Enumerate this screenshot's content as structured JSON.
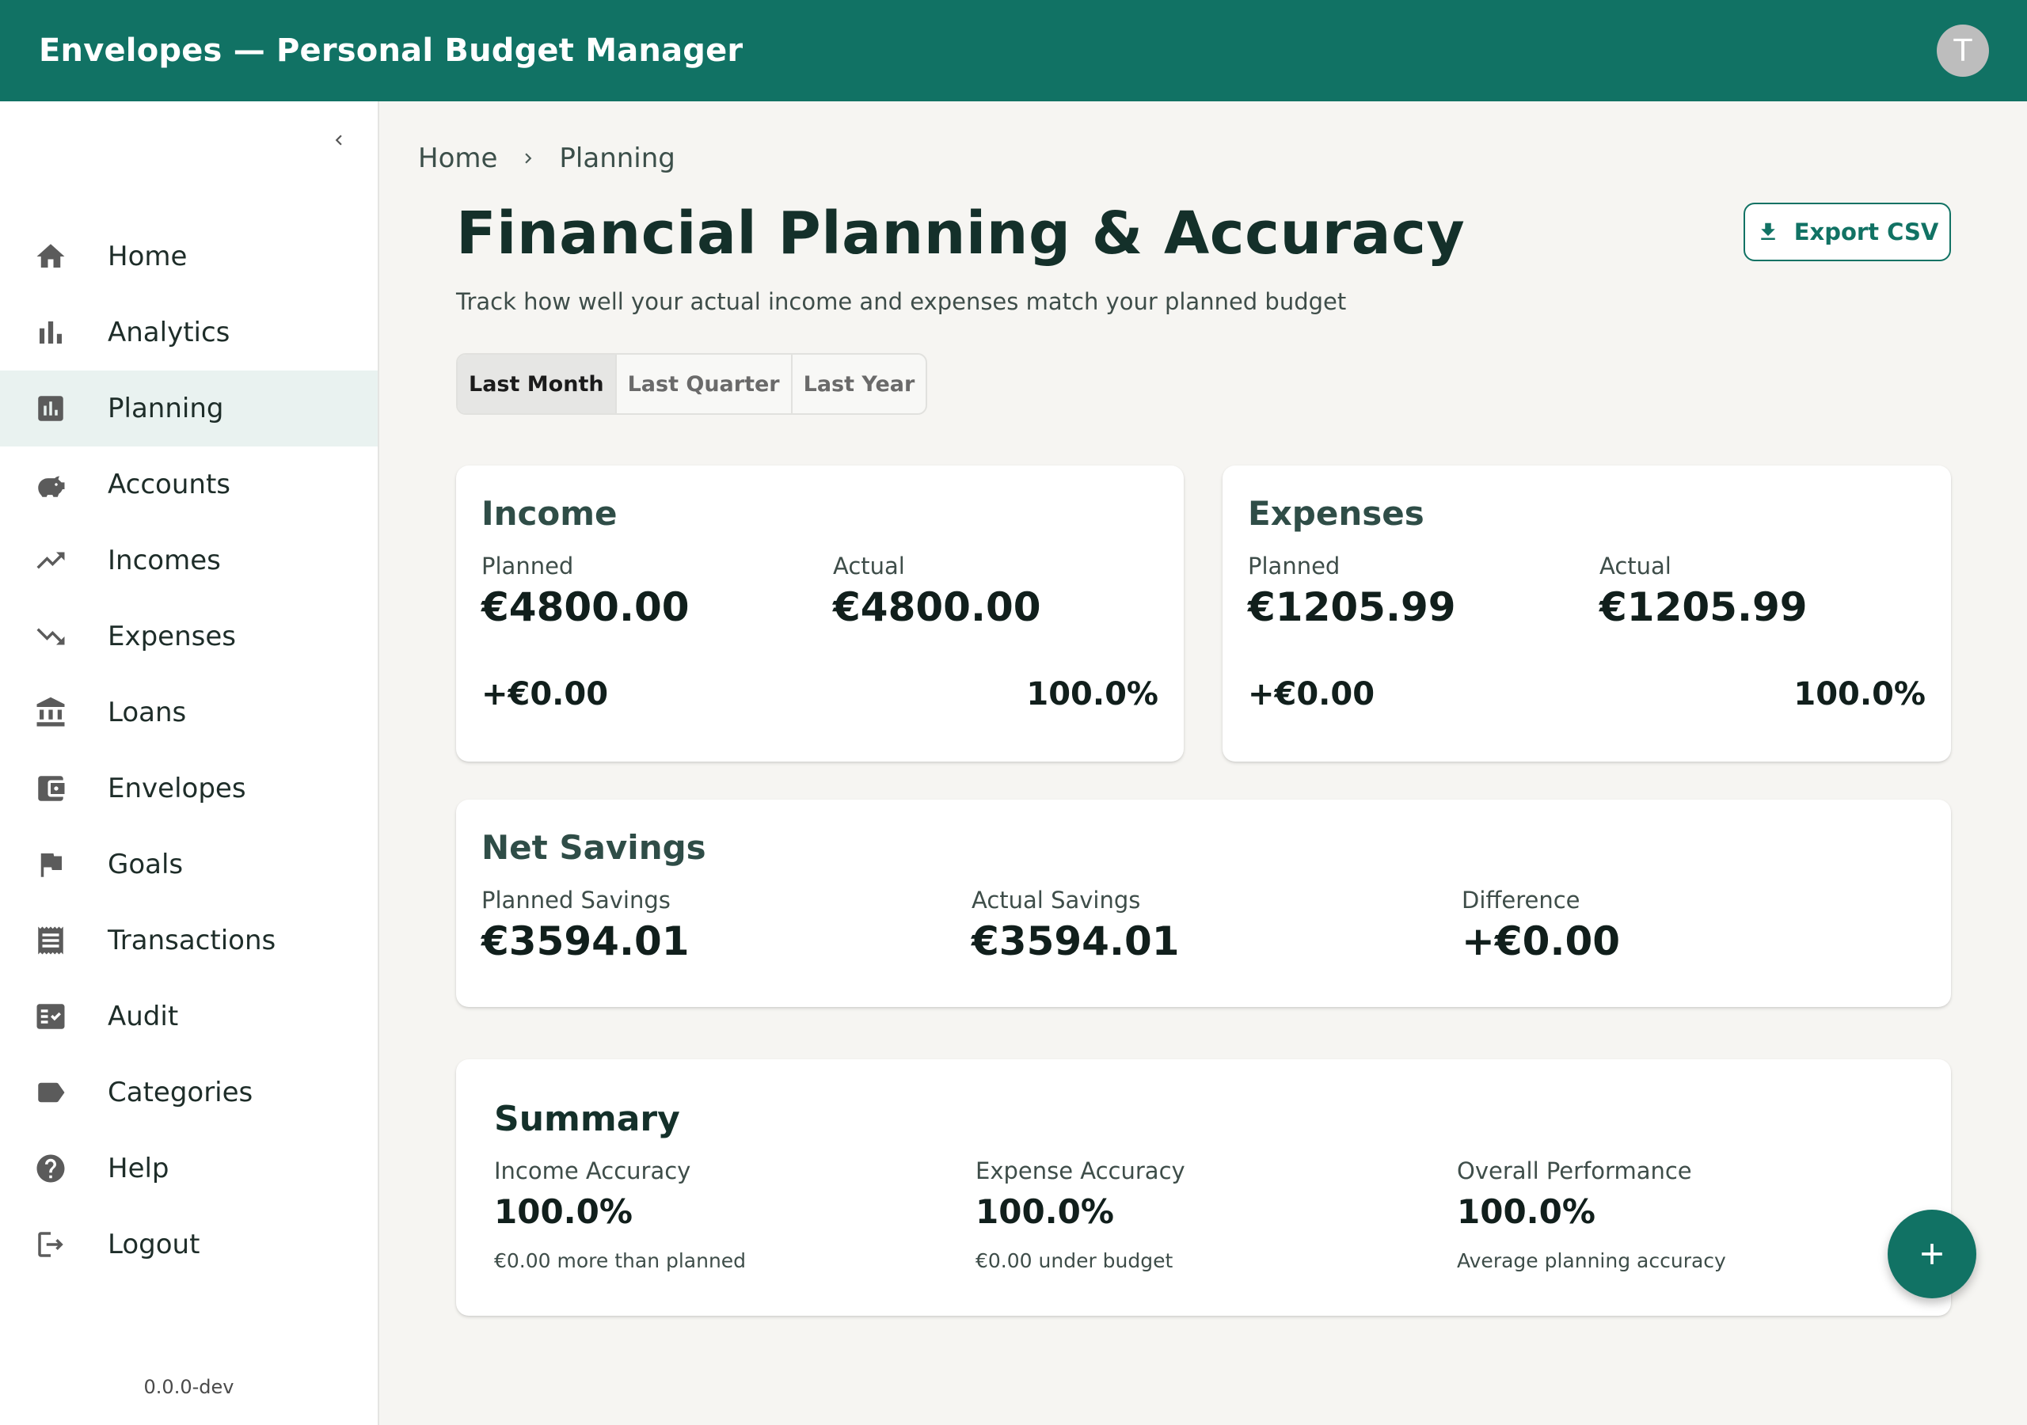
{
  "app": {
    "title": "Envelopes — Personal Budget Manager",
    "avatar_initial": "T"
  },
  "sidebar": {
    "items": [
      {
        "label": "Home",
        "icon": "home-icon"
      },
      {
        "label": "Analytics",
        "icon": "bar-chart-icon"
      },
      {
        "label": "Planning",
        "icon": "planning-icon",
        "active": true
      },
      {
        "label": "Accounts",
        "icon": "piggy-bank-icon"
      },
      {
        "label": "Incomes",
        "icon": "trending-up-icon"
      },
      {
        "label": "Expenses",
        "icon": "trending-down-icon"
      },
      {
        "label": "Loans",
        "icon": "bank-icon"
      },
      {
        "label": "Envelopes",
        "icon": "wallet-icon"
      },
      {
        "label": "Goals",
        "icon": "flag-icon"
      },
      {
        "label": "Transactions",
        "icon": "receipt-icon"
      },
      {
        "label": "Audit",
        "icon": "fact-check-icon"
      },
      {
        "label": "Categories",
        "icon": "label-icon"
      },
      {
        "label": "Help",
        "icon": "help-icon"
      },
      {
        "label": "Logout",
        "icon": "logout-icon"
      }
    ],
    "version": "0.0.0-dev"
  },
  "breadcrumb": {
    "home": "Home",
    "current": "Planning"
  },
  "page": {
    "title": "Financial Planning & Accuracy",
    "subtitle": "Track how well your actual income and expenses match your planned budget",
    "export_label": "Export CSV"
  },
  "period_toggle": {
    "options": [
      "Last Month",
      "Last Quarter",
      "Last Year"
    ],
    "selected": "Last Month"
  },
  "income": {
    "title": "Income",
    "planned_label": "Planned",
    "planned": "€4800.00",
    "actual_label": "Actual",
    "actual": "€4800.00",
    "difference": "+€0.00",
    "accuracy": "100.0%"
  },
  "expenses": {
    "title": "Expenses",
    "planned_label": "Planned",
    "planned": "€1205.99",
    "actual_label": "Actual",
    "actual": "€1205.99",
    "difference": "+€0.00",
    "accuracy": "100.0%"
  },
  "net_savings": {
    "title": "Net Savings",
    "planned_label": "Planned Savings",
    "planned": "€3594.01",
    "actual_label": "Actual Savings",
    "actual": "€3594.01",
    "difference_label": "Difference",
    "difference": "+€0.00"
  },
  "summary": {
    "title": "Summary",
    "income_label": "Income Accuracy",
    "income_value": "100.0%",
    "income_note": "€0.00 more than planned",
    "expense_label": "Expense Accuracy",
    "expense_value": "100.0%",
    "expense_note": "€0.00 under budget",
    "overall_label": "Overall Performance",
    "overall_value": "100.0%",
    "overall_note": "Average planning accuracy"
  },
  "colors": {
    "primary": "#117264",
    "background": "#f6f5f2",
    "active_nav": "#e9f2f0"
  }
}
